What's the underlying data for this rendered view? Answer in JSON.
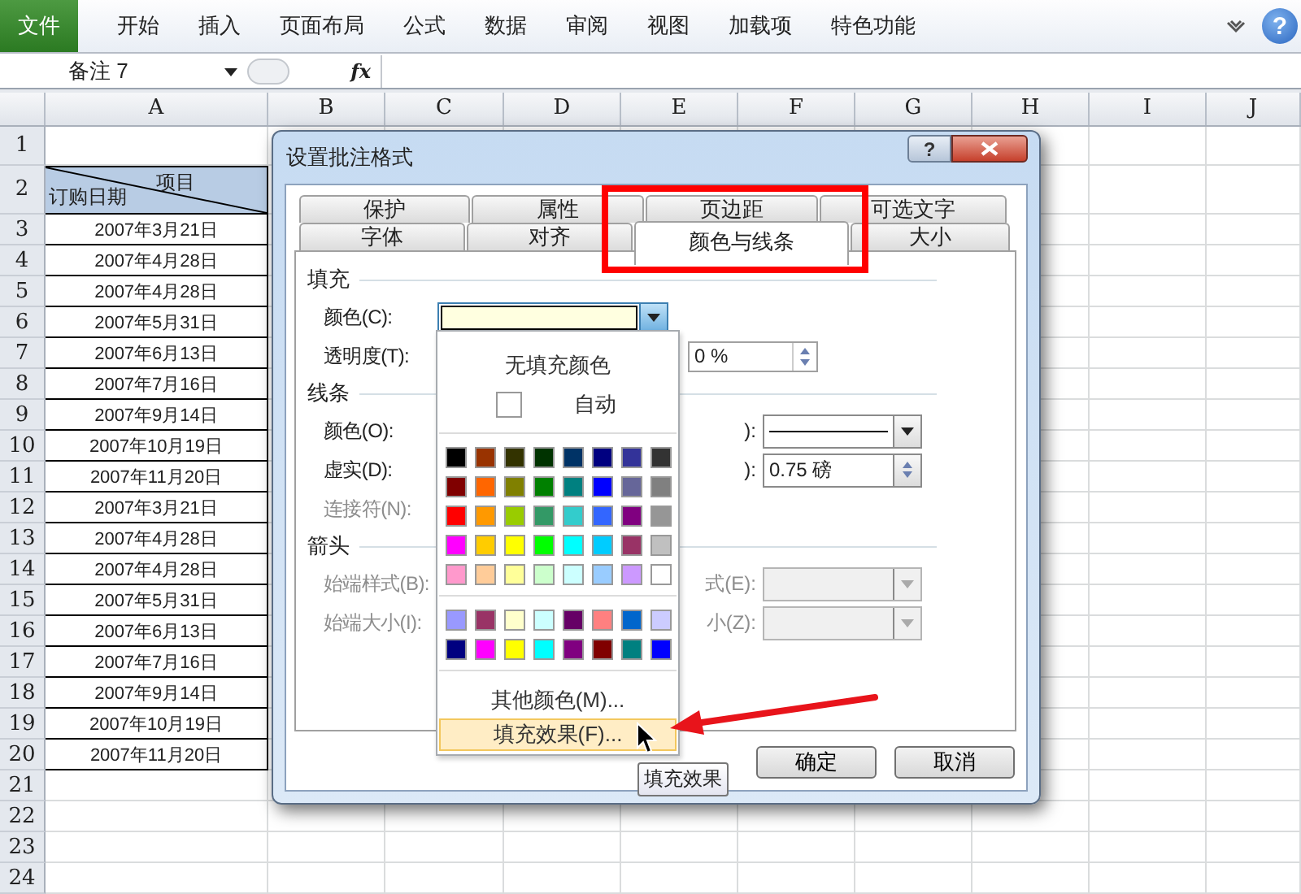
{
  "ribbon": {
    "tabs": [
      {
        "label": "文件",
        "kind": "file"
      },
      {
        "label": "开始",
        "kind": "tab"
      },
      {
        "label": "插入",
        "kind": "tab"
      },
      {
        "label": "页面布局",
        "kind": "tab"
      },
      {
        "label": "公式",
        "kind": "tab"
      },
      {
        "label": "数据",
        "kind": "tab"
      },
      {
        "label": "审阅",
        "kind": "tab"
      },
      {
        "label": "视图",
        "kind": "tab"
      },
      {
        "label": "加载项",
        "kind": "tab"
      },
      {
        "label": "特色功能",
        "kind": "tab"
      }
    ],
    "help_glyph": "?"
  },
  "name_box": {
    "value": "备注 7"
  },
  "formula_bar": {
    "function_label": "fx"
  },
  "sheet": {
    "columns": [
      "A",
      "B",
      "C",
      "D",
      "E",
      "F",
      "G",
      "H",
      "I",
      "J"
    ],
    "row_numbers": [
      "1",
      "2",
      "3",
      "4",
      "5",
      "6",
      "7",
      "8",
      "9",
      "10",
      "11",
      "12",
      "13",
      "14",
      "15",
      "16",
      "17",
      "18",
      "19",
      "20",
      "21",
      "22",
      "23",
      "24"
    ],
    "header_cell": {
      "top_label": "项目",
      "bottom_label": "订购日期"
    },
    "dates": [
      "2007年3月21日",
      "2007年4月28日",
      "2007年4月28日",
      "2007年5月31日",
      "2007年6月13日",
      "2007年7月16日",
      "2007年9月14日",
      "2007年10月19日",
      "2007年11月20日",
      "2007年3月21日",
      "2007年4月28日",
      "2007年4月28日",
      "2007年5月31日",
      "2007年6月13日",
      "2007年7月16日",
      "2007年9月14日",
      "2007年10月19日",
      "2007年11月20日"
    ]
  },
  "dialog": {
    "title": "设置批注格式",
    "help_button": "?",
    "tabs_back": [
      {
        "label": "保护",
        "selected": false
      },
      {
        "label": "属性",
        "selected": false
      },
      {
        "label": "页边距",
        "selected": false
      },
      {
        "label": "可选文字",
        "selected": false
      }
    ],
    "tabs_front": [
      {
        "label": "字体",
        "selected": false
      },
      {
        "label": "对齐",
        "selected": false
      },
      {
        "label": "颜色与线条",
        "selected": true
      },
      {
        "label": "大小",
        "selected": false
      }
    ],
    "fill": {
      "heading": "填充",
      "color_label": "颜色(C):",
      "color": "#ffffe0",
      "transparency_label": "透明度(T):",
      "transparency_value": "0 %"
    },
    "line": {
      "heading": "线条",
      "color_label": "颜色(O):",
      "style_label": "):",
      "dash_label": "虚实(D):",
      "weight_label": "):",
      "weight_value": "0.75 磅",
      "connector_label": "连接符(N):",
      "connector_disabled": true
    },
    "arrows": {
      "heading": "箭头",
      "rows": [
        {
          "label": "始端样式(B):",
          "right_label": "式(E):",
          "disabled": true
        },
        {
          "label": "始端大小(I):",
          "right_label": "小(Z):",
          "disabled": true
        }
      ]
    },
    "buttons": [
      "确定",
      "取消"
    ]
  },
  "color_menu": {
    "no_fill": "无填充颜色",
    "automatic": "自动",
    "standard_colors": [
      {
        "color": "#000000"
      },
      {
        "color": "#993300"
      },
      {
        "color": "#333300"
      },
      {
        "color": "#003300"
      },
      {
        "color": "#003366"
      },
      {
        "color": "#000080"
      },
      {
        "color": "#333399"
      },
      {
        "color": "#333333"
      },
      {
        "color": "#800000"
      },
      {
        "color": "#ff6600"
      },
      {
        "color": "#808000"
      },
      {
        "color": "#008000"
      },
      {
        "color": "#008080"
      },
      {
        "color": "#0000ff"
      },
      {
        "color": "#666699"
      },
      {
        "color": "#808080"
      },
      {
        "color": "#ff0000"
      },
      {
        "color": "#ff9900"
      },
      {
        "color": "#99cc00"
      },
      {
        "color": "#339966"
      },
      {
        "color": "#33cccc"
      },
      {
        "color": "#3366ff"
      },
      {
        "color": "#800080"
      },
      {
        "color": "#969696"
      },
      {
        "color": "#ff00ff"
      },
      {
        "color": "#ffcc00"
      },
      {
        "color": "#ffff00"
      },
      {
        "color": "#00ff00"
      },
      {
        "color": "#00ffff"
      },
      {
        "color": "#00ccff"
      },
      {
        "color": "#993366"
      },
      {
        "color": "#c0c0c0"
      },
      {
        "color": "#ff99cc"
      },
      {
        "color": "#ffcc99"
      },
      {
        "color": "#ffff99"
      },
      {
        "color": "#ccffcc"
      },
      {
        "color": "#ccffff"
      },
      {
        "color": "#99ccff"
      },
      {
        "color": "#cc99ff"
      },
      {
        "color": "#ffffff"
      }
    ],
    "custom_colors": [
      {
        "color": "#9999ff"
      },
      {
        "color": "#993366"
      },
      {
        "color": "#ffffcc"
      },
      {
        "color": "#ccffff"
      },
      {
        "color": "#660066"
      },
      {
        "color": "#ff8080"
      },
      {
        "color": "#0066cc"
      },
      {
        "color": "#ccccff"
      },
      {
        "color": "#000080"
      },
      {
        "color": "#ff00ff"
      },
      {
        "color": "#ffff00"
      },
      {
        "color": "#00ffff"
      },
      {
        "color": "#800080"
      },
      {
        "color": "#800000"
      },
      {
        "color": "#008080"
      },
      {
        "color": "#0000ff"
      }
    ],
    "more_colors": "其他颜色(M)...",
    "fill_effects": {
      "label": "填充效果(F)...",
      "highlighted": true
    }
  },
  "tooltip": "填充效果"
}
